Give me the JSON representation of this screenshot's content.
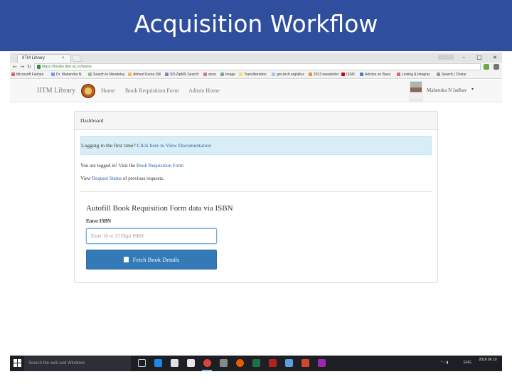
{
  "slide": {
    "title": "Acquisition Workflow"
  },
  "browser": {
    "tab_title": "IITM Library",
    "tab_close": "×",
    "window_user": "",
    "window_buttons": {
      "minimize": "–",
      "maximize": "□",
      "close": "×"
    },
    "url": "https://books.iitm.ac.in/home",
    "bookmarks": [
      "Microsoft Fashan",
      "Dr. Mahendra N.",
      "Search in Mendeley",
      "Ahmed Kursa ISK",
      "SD-ZipMS Search",
      "anon",
      "Image",
      "Transliteration",
      "gov.tech.org/alluz",
      "2013 newsletter",
      "ISSN",
      "Articles on Baza",
      "Linking & Integrat",
      "Search | Chatur"
    ]
  },
  "site": {
    "brand": "IITM Library",
    "nav": [
      "Home",
      "Book Requisition Form",
      "Admin Home"
    ],
    "user_name": "Mahendra N Jadhav",
    "user_caret": "▾"
  },
  "dashboard": {
    "heading": "Dashboard",
    "alert_text": "Logging in the first time? ",
    "alert_link": "Click here to View Documentation",
    "logged_in_prefix": "You are logged in! Visit the ",
    "logged_in_link": "Book Requisition Form",
    "view_prefix": "View ",
    "view_link": "Request Status",
    "view_suffix": " of previous requests.",
    "autofill_title": "Autofill Book Requisition Form data via ISBN",
    "isbn_label": "Enter ISBN",
    "isbn_placeholder": "Enter 10 or 13 Digit ISBN",
    "isbn_value": "",
    "fetch_label": "Fetch Book Details"
  },
  "taskbar": {
    "search_placeholder": "Search the web and Windows",
    "time": "",
    "date": "2016 06 10",
    "lang": "ENG"
  },
  "colors": {
    "slide_header": "#2f4e9e",
    "primary_button": "#337ab7",
    "alert_bg": "#d9edf7",
    "link": "#2a5f9e",
    "taskbar": "#1d1f24"
  }
}
